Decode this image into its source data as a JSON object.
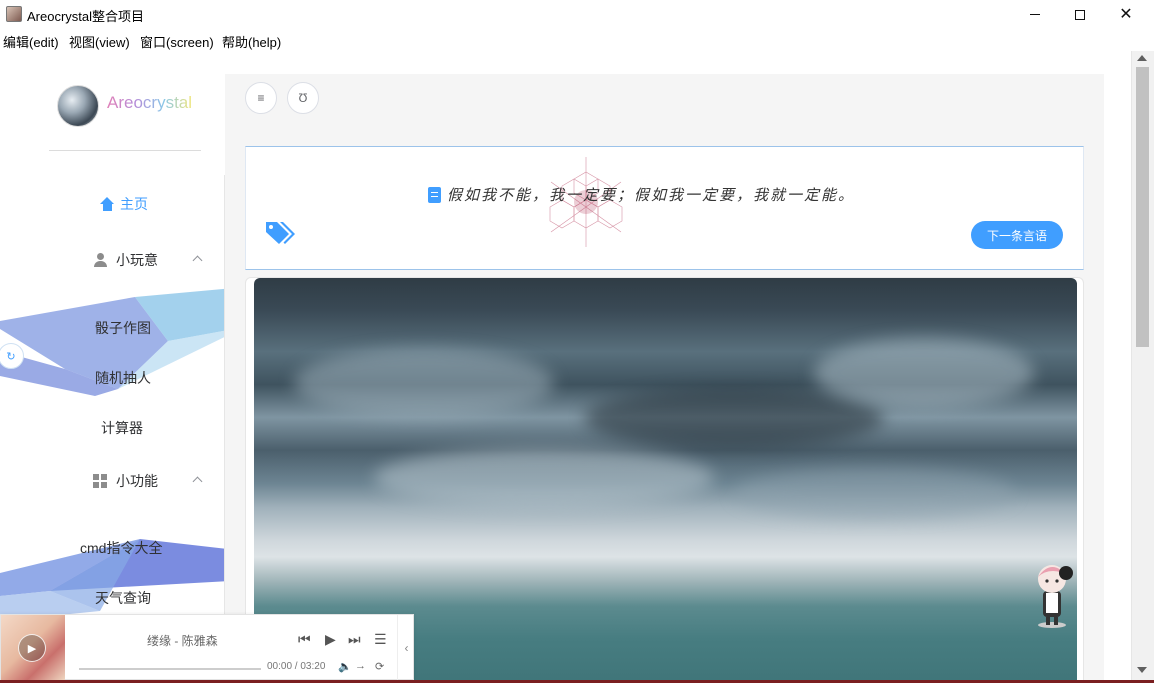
{
  "window": {
    "title": "Areocrystal整合项目"
  },
  "menu": [
    {
      "label": "编辑(edit)"
    },
    {
      "label": "视图(view)"
    },
    {
      "label": "窗口(screen)"
    },
    {
      "label": "帮助(help)"
    }
  ],
  "sidebar": {
    "brand": "Areocrystal",
    "home_label": "主页",
    "group_toys": {
      "label": "小玩意",
      "items": [
        "骰子作图",
        "随机抽人",
        "计算器"
      ]
    },
    "group_tools": {
      "label": "小功能",
      "items": [
        "cmd指令大全",
        "天气查询"
      ]
    }
  },
  "toolbar": {
    "menu_icon": "≡",
    "second_icon": "Ʊ"
  },
  "quote": {
    "text": "假如我不能，我一定要；假如我一定要，我就一定能。",
    "next_label": "下一条言语"
  },
  "player": {
    "song": "缕缘 - 陈雅森",
    "time": "00:00 / 03:20"
  },
  "colors": {
    "accent": "#409eff",
    "window_border": "#7a1f20"
  }
}
